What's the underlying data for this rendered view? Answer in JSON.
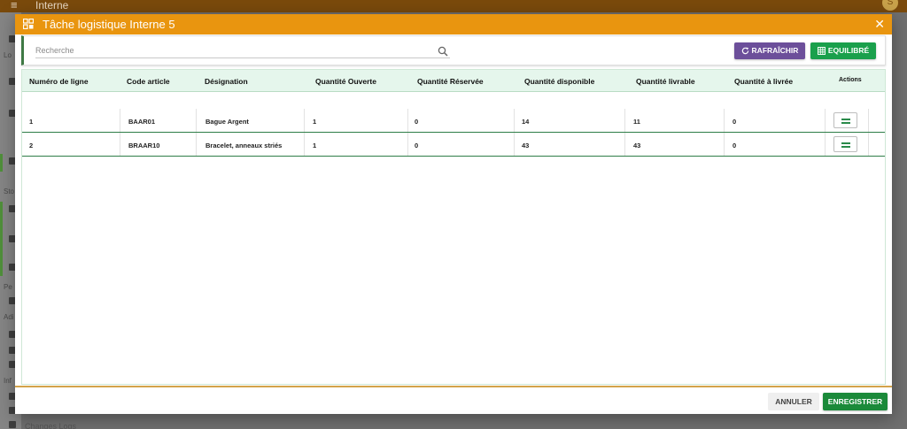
{
  "app": {
    "title": "Interne",
    "avatar_initial": "S",
    "sidebar_labels": [
      "Lo",
      "Sto",
      "Pe",
      "Adi",
      "Inf"
    ],
    "bottom_text": "Changes Logs"
  },
  "modal": {
    "title": "Tâche logistique Interne 5",
    "close_glyph": "✕"
  },
  "toolbar": {
    "search_placeholder": "Recherche",
    "refresh_label": "RAFRAÎCHIR",
    "equilibrate_label": "EQUILIBRÉ"
  },
  "table": {
    "headers": [
      "Numéro de ligne",
      "Code article",
      "Désignation",
      "Quantité Ouverte",
      "Quantité Réservée",
      "Quantité disponible",
      "Quantité livrable",
      "Quantité à livrée",
      "Actions"
    ],
    "rows": [
      [
        "1",
        "BAAR01",
        "Bague Argent",
        "1",
        "0",
        "14",
        "11",
        "0"
      ],
      [
        "2",
        "BRAAR10",
        "Bracelet, anneaux striés",
        "1",
        "0",
        "43",
        "43",
        "0"
      ]
    ]
  },
  "footer": {
    "cancel_label": "ANNULER",
    "save_label": "ENREGISTRER"
  },
  "colors": {
    "header": "#e9950f",
    "refresh": "#6c4f9a",
    "equilibrate": "#1aa04c",
    "save": "#1b8a3a"
  },
  "icons": [
    "menu-icon",
    "task-icon",
    "close-icon",
    "search-icon",
    "refresh-icon",
    "table-icon",
    "menu-lines-icon"
  ]
}
